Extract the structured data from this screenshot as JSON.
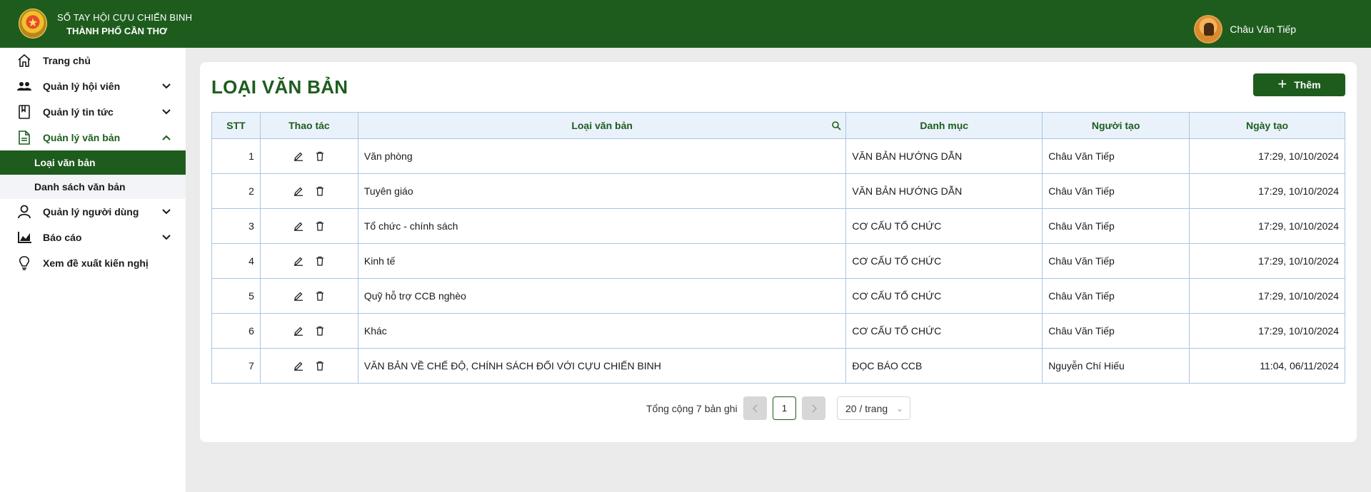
{
  "header": {
    "brand_line1": "SỔ TAY HỘI CỰU CHIẾN BINH",
    "brand_line2": "THÀNH PHỐ CẦN THƠ",
    "user_name": "Châu Văn Tiếp"
  },
  "sidebar": {
    "items": [
      {
        "label": "Trang chủ",
        "icon": "home-icon"
      },
      {
        "label": "Quản lý hội viên",
        "icon": "users-icon"
      },
      {
        "label": "Quản lý tin tức",
        "icon": "book-icon"
      },
      {
        "label": "Quản lý văn bản",
        "icon": "document-icon"
      },
      {
        "label": "Quản lý người dùng",
        "icon": "user-icon"
      },
      {
        "label": "Báo cáo",
        "icon": "chart-icon"
      },
      {
        "label": "Xem đề xuất kiến nghị",
        "icon": "lightbulb-icon"
      }
    ],
    "subitems": [
      {
        "label": "Loại văn bản"
      },
      {
        "label": "Danh sách văn bản"
      }
    ]
  },
  "main": {
    "title": "LOẠI VĂN BẢN",
    "add_label": "Thêm",
    "columns": [
      "STT",
      "Thao tác",
      "Loại văn bản",
      "Danh mục",
      "Người tạo",
      "Ngày tạo"
    ],
    "rows": [
      {
        "stt": "1",
        "name": "Văn phòng",
        "category": "VĂN BẢN HƯỚNG DẪN",
        "creator": "Châu Văn Tiếp",
        "date": "17:29, 10/10/2024"
      },
      {
        "stt": "2",
        "name": "Tuyên giáo",
        "category": "VĂN BẢN HƯỚNG DẪN",
        "creator": "Châu Văn Tiếp",
        "date": "17:29, 10/10/2024"
      },
      {
        "stt": "3",
        "name": "Tổ chức - chính sách",
        "category": "CƠ CẤU TỔ CHỨC",
        "creator": "Châu Văn Tiếp",
        "date": "17:29, 10/10/2024"
      },
      {
        "stt": "4",
        "name": "Kinh tế",
        "category": "CƠ CẤU TỔ CHỨC",
        "creator": "Châu Văn Tiếp",
        "date": "17:29, 10/10/2024"
      },
      {
        "stt": "5",
        "name": "Quỹ hỗ trợ CCB nghèo",
        "category": "CƠ CẤU TỔ CHỨC",
        "creator": "Châu Văn Tiếp",
        "date": "17:29, 10/10/2024"
      },
      {
        "stt": "6",
        "name": "Khác",
        "category": "CƠ CẤU TỔ CHỨC",
        "creator": "Châu Văn Tiếp",
        "date": "17:29, 10/10/2024"
      },
      {
        "stt": "7",
        "name": "VĂN BẢN VỀ CHẾ ĐỘ, CHÍNH SÁCH ĐỐI VỚI CỰU CHIẾN BINH",
        "category": "ĐỌC BÁO CCB",
        "creator": "Nguyễn Chí Hiếu",
        "date": "11:04, 06/11/2024"
      }
    ]
  },
  "pagination": {
    "total_text": "Tổng cộng 7 bản ghi",
    "current_page": "1",
    "page_size": "20 / trang"
  },
  "colors": {
    "primary": "#1e5c1e",
    "header_bg": "#e9f2fb",
    "border": "#aac5e2"
  }
}
